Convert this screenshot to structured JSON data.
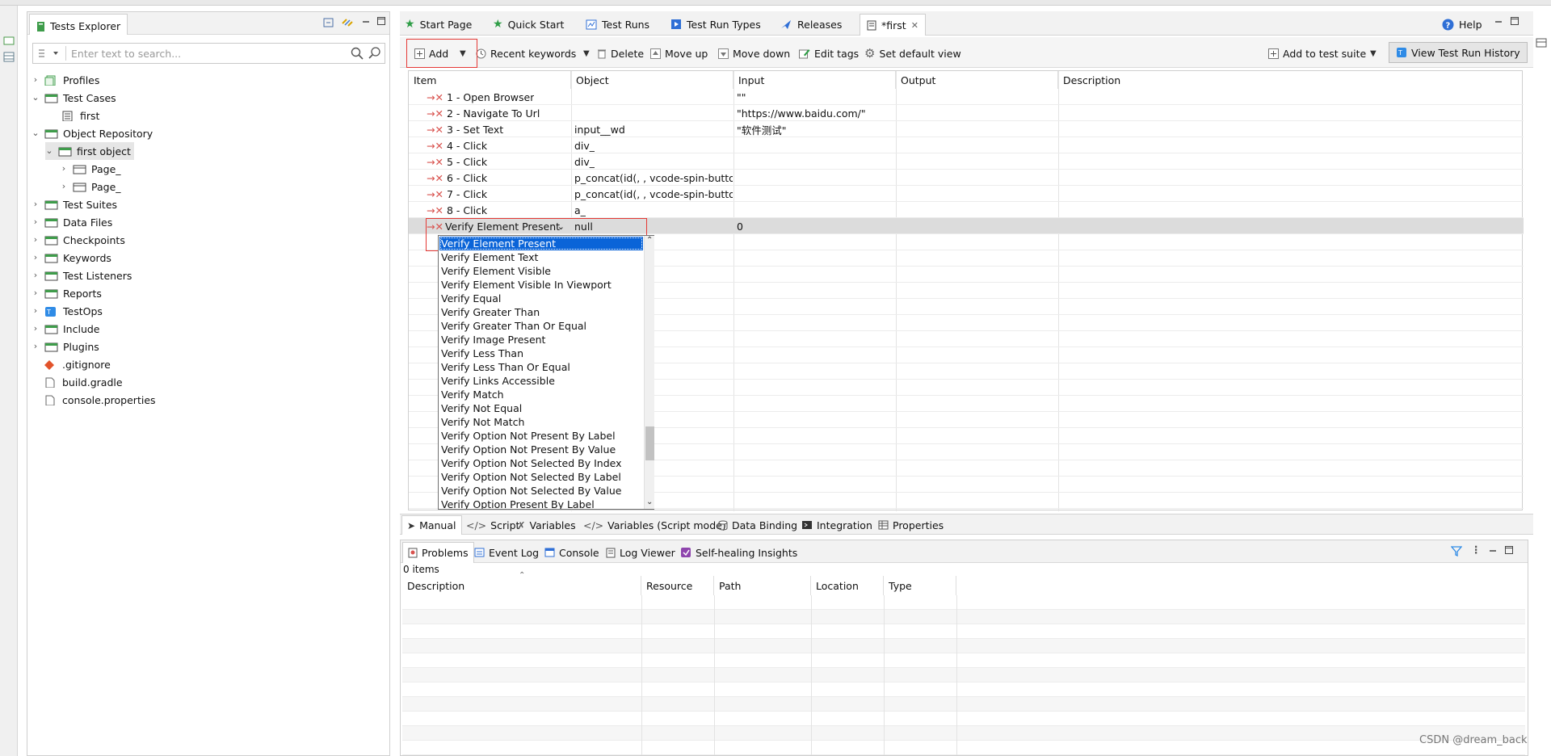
{
  "explorer": {
    "title": "Tests Explorer",
    "search_placeholder": "Enter text to search...",
    "tree": [
      {
        "label": "Profiles"
      },
      {
        "label": "Test Cases"
      },
      {
        "label": "first"
      },
      {
        "label": "Object Repository"
      },
      {
        "label": "first object"
      },
      {
        "label": "Page_"
      },
      {
        "label": "Page_"
      },
      {
        "label": "Test Suites"
      },
      {
        "label": "Data Files"
      },
      {
        "label": "Checkpoints"
      },
      {
        "label": "Keywords"
      },
      {
        "label": "Test Listeners"
      },
      {
        "label": "Reports"
      },
      {
        "label": "TestOps"
      },
      {
        "label": "Include"
      },
      {
        "label": "Plugins"
      },
      {
        "label": ".gitignore"
      },
      {
        "label": "build.gradle"
      },
      {
        "label": "console.properties"
      }
    ]
  },
  "editor_tabs": [
    {
      "label": "Start Page"
    },
    {
      "label": "Quick Start"
    },
    {
      "label": "Test Runs"
    },
    {
      "label": "Test Run Types"
    },
    {
      "label": "Releases"
    },
    {
      "label": "*first"
    }
  ],
  "help_label": "Help",
  "toolbar": {
    "add": "Add",
    "recent_keywords": "Recent keywords",
    "delete": "Delete",
    "move_up": "Move up",
    "move_down": "Move down",
    "edit_tags": "Edit tags",
    "set_default_view": "Set default view",
    "add_to_test_suite": "Add to test suite",
    "view_history": "View Test Run History"
  },
  "grid": {
    "columns": [
      "Item",
      "Object",
      "Input",
      "Output",
      "Description"
    ],
    "rows": [
      {
        "item": "1 - Open Browser",
        "object": "",
        "input": "\"\""
      },
      {
        "item": "2 - Navigate To Url",
        "object": "",
        "input": "\"https://www.baidu.com/\""
      },
      {
        "item": "3 - Set Text",
        "object": "input__wd",
        "input": "\"软件测试\""
      },
      {
        "item": "4 - Click",
        "object": "div_",
        "input": ""
      },
      {
        "item": "5 - Click",
        "object": "div_",
        "input": ""
      },
      {
        "item": "6 - Click",
        "object": "p_concat(id(, , vcode-spin-button-",
        "input": ""
      },
      {
        "item": "7 - Click",
        "object": "p_concat(id(, , vcode-spin-button-",
        "input": ""
      },
      {
        "item": "8 - Click",
        "object": "a_",
        "input": ""
      },
      {
        "item": "Verify Element Present",
        "object": "null",
        "input": "0"
      }
    ]
  },
  "dropdown": {
    "items": [
      "Verify Element Present",
      "Verify Element Text",
      "Verify Element Visible",
      "Verify Element Visible In Viewport",
      "Verify Equal",
      "Verify Greater Than",
      "Verify Greater Than Or Equal",
      "Verify Image Present",
      "Verify Less Than",
      "Verify Less Than Or Equal",
      "Verify Links Accessible",
      "Verify Match",
      "Verify Not Equal",
      "Verify Not Match",
      "Verify Option Not Present By Label",
      "Verify Option Not Present By Value",
      "Verify Option Not Selected By Index",
      "Verify Option Not Selected By Label",
      "Verify Option Not Selected By Value",
      "Verify Option Present By Label"
    ],
    "selected_index": 0
  },
  "bottom_tabs": [
    {
      "label": "Manual"
    },
    {
      "label": "Script"
    },
    {
      "label": "Variables"
    },
    {
      "label": "Variables (Script mode)"
    },
    {
      "label": "Data Binding"
    },
    {
      "label": "Integration"
    },
    {
      "label": "Properties"
    }
  ],
  "problems": {
    "tabs": [
      {
        "label": "Problems"
      },
      {
        "label": "Event Log"
      },
      {
        "label": "Console"
      },
      {
        "label": "Log Viewer"
      },
      {
        "label": "Self-healing Insights"
      }
    ],
    "count": "0 items",
    "columns": [
      "Description",
      "Resource",
      "Path",
      "Location",
      "Type"
    ]
  },
  "watermark": "CSDN @dream_back",
  "colors": {
    "selection": "#0a64d8",
    "highlight_box": "#e53935",
    "accent_green": "#2e9d46"
  }
}
